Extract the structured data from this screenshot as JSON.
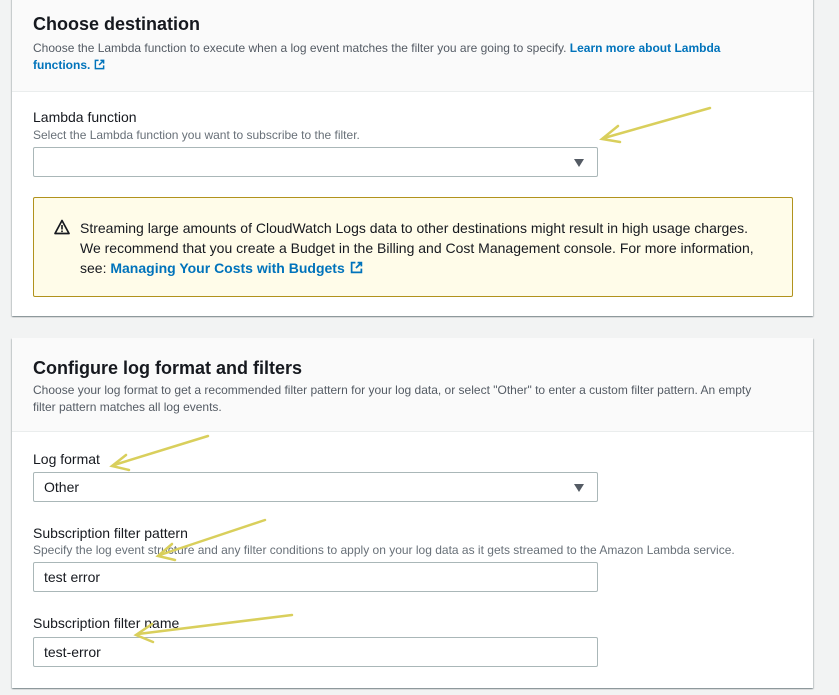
{
  "destination": {
    "title": "Choose destination",
    "description": "Choose the Lambda function to execute when a log event matches the filter you are going to specify.",
    "learn_more_line1": "Learn more about Lambda",
    "learn_more_line2": "functions.",
    "lambda_label": "Lambda function",
    "lambda_desc": "Select the Lambda function you want to subscribe to the filter.",
    "lambda_value": "",
    "alert_line1": "Streaming large amounts of CloudWatch Logs data to other destinations might result in high usage charges.",
    "alert_line2": "We recommend that you create a Budget in the Billing and Cost Management console. For more information,",
    "alert_line3_prefix": "see:",
    "alert_link": "Managing Your Costs with Budgets"
  },
  "configure": {
    "title": "Configure log format and filters",
    "description_line1": "Choose your log format to get a recommended filter pattern for your log data, or select \"Other\" to enter a custom filter pattern. An empty",
    "description_line2": "filter pattern matches all log events.",
    "log_format_label": "Log format",
    "log_format_value": "Other",
    "pattern_label": "Subscription filter pattern",
    "pattern_desc": "Specify the log event structure and any filter conditions to apply on your log data as it gets streamed to the Amazon Lambda service.",
    "pattern_value": "test error",
    "name_label": "Subscription filter name",
    "name_value": "test-error"
  },
  "colors": {
    "link": "#0073bb",
    "alert_border": "#b1921c",
    "alert_bg": "#fffce9",
    "annotation_arrow": "#d9cf5c"
  },
  "icons": {
    "external_link": "external-link-icon",
    "warning": "warning-icon",
    "dropdown": "caret-down-icon"
  }
}
